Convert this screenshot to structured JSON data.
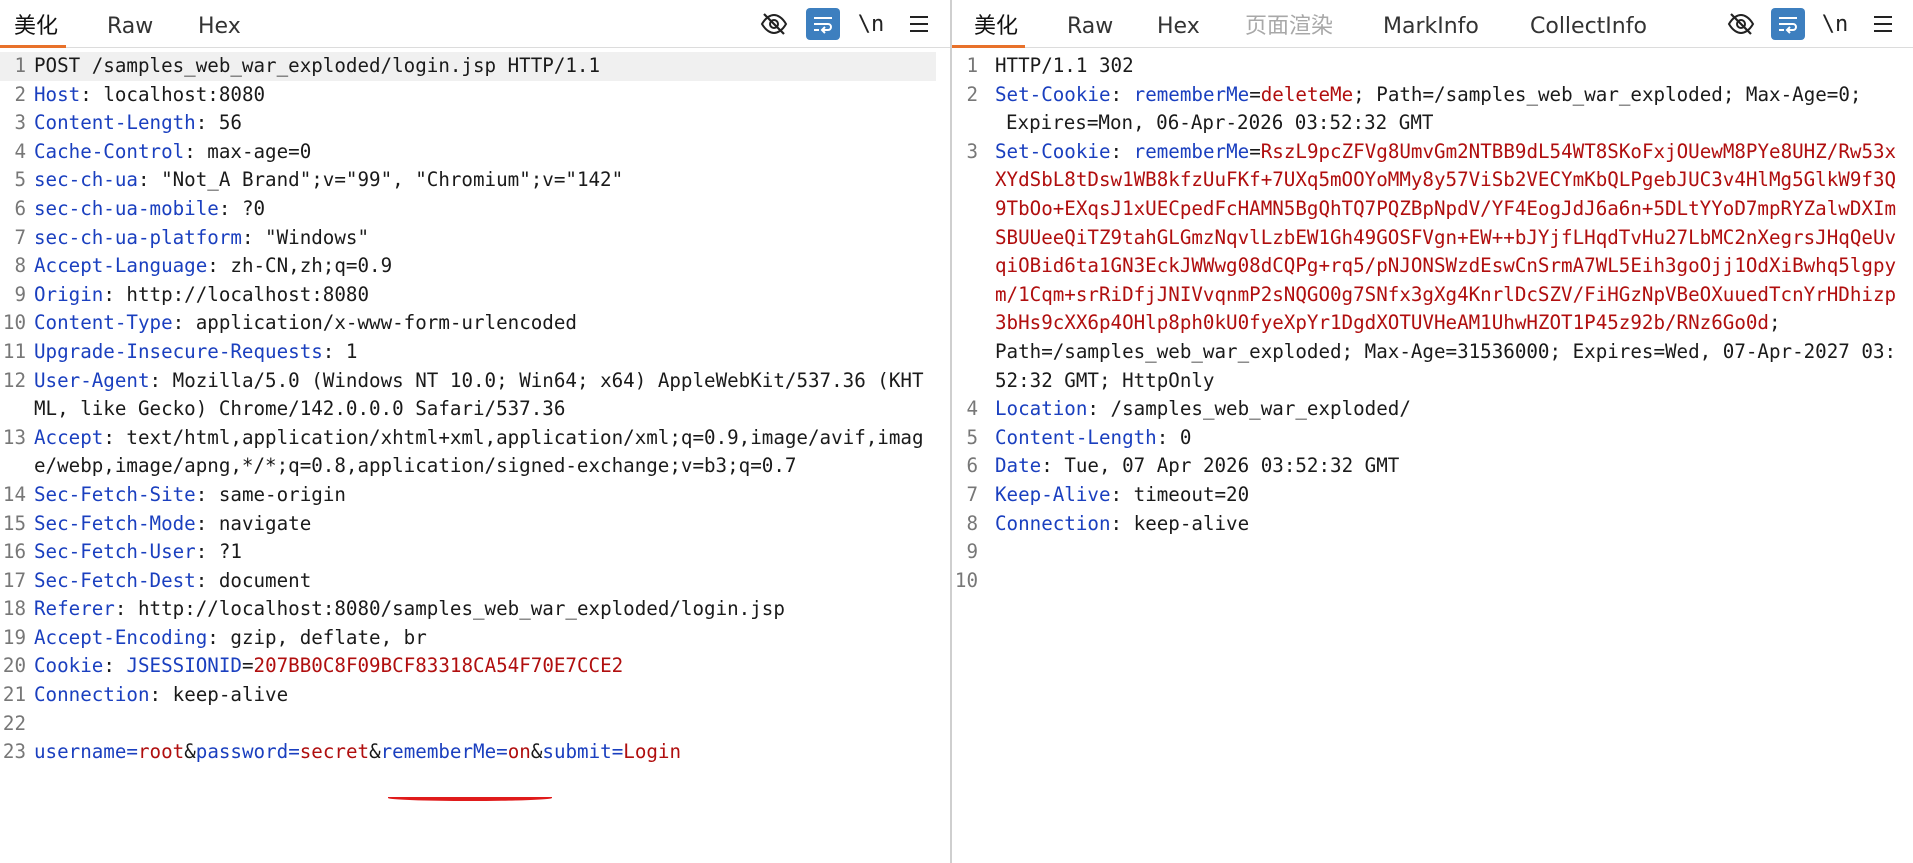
{
  "request_pane": {
    "tabs": [
      "美化",
      "Raw",
      "Hex"
    ],
    "active_tab": "美化",
    "toolbar": {
      "hide_icon": "eye-slash-icon",
      "wrap_icon": "wrap-lines-icon",
      "newline_label": "\\n",
      "menu_icon": "hamburger-menu-icon"
    },
    "lines": [
      {
        "n": "1",
        "request_line": "POST /samples_web_war_exploded/login.jsp HTTP/1.1"
      },
      {
        "n": "2",
        "name": "Host",
        "value": " localhost:8080"
      },
      {
        "n": "3",
        "name": "Content-Length",
        "value": " 56"
      },
      {
        "n": "4",
        "name": "Cache-Control",
        "value": " max-age=0"
      },
      {
        "n": "5",
        "name": "sec-ch-ua",
        "value": " \"Not_A Brand\";v=\"99\", \"Chromium\";v=\"142\""
      },
      {
        "n": "6",
        "name": "sec-ch-ua-mobile",
        "value": " ?0"
      },
      {
        "n": "7",
        "name": "sec-ch-ua-platform",
        "value": " \"Windows\""
      },
      {
        "n": "8",
        "name": "Accept-Language",
        "value": " zh-CN,zh;q=0.9"
      },
      {
        "n": "9",
        "name": "Origin",
        "value": " http://localhost:8080"
      },
      {
        "n": "10",
        "name": "Content-Type",
        "value": " application/x-www-form-urlencoded"
      },
      {
        "n": "11",
        "name": "Upgrade-Insecure-Requests",
        "value": " 1"
      },
      {
        "n": "12",
        "name": "User-Agent",
        "value": " Mozilla/5.0 (Windows NT 10.0; Win64; x64) AppleWebKit/537.36 (KHTML, like Gecko) Chrome/142.0.0.0 Safari/537.36"
      },
      {
        "n": "13",
        "name": "Accept",
        "value": " text/html,application/xhtml+xml,application/xml;q=0.9,image/avif,image/webp,image/apng,*/*;q=0.8,application/signed-exchange;v=b3;q=0.7"
      },
      {
        "n": "14",
        "name": "Sec-Fetch-Site",
        "value": " same-origin"
      },
      {
        "n": "15",
        "name": "Sec-Fetch-Mode",
        "value": " navigate"
      },
      {
        "n": "16",
        "name": "Sec-Fetch-User",
        "value": " ?1"
      },
      {
        "n": "17",
        "name": "Sec-Fetch-Dest",
        "value": " document"
      },
      {
        "n": "18",
        "name": "Referer",
        "value": " http://localhost:8080/samples_web_war_exploded/login.jsp"
      },
      {
        "n": "19",
        "name": "Accept-Encoding",
        "value": " gzip, deflate, br"
      },
      {
        "n": "20",
        "name": "Cookie",
        "cookie_name": "JSESSIONID",
        "cookie_value": "207BB0C8F09BCF83318CA54F70E7CCE2"
      },
      {
        "n": "21",
        "name": "Connection",
        "value": " keep-alive"
      },
      {
        "n": "22"
      },
      {
        "n": "23",
        "body_params": [
          {
            "k": "username",
            "v": "root"
          },
          {
            "k": "password",
            "v": "secret"
          },
          {
            "k": "rememberMe",
            "v": "on"
          },
          {
            "k": "submit",
            "v": "Login"
          }
        ]
      }
    ]
  },
  "response_pane": {
    "tabs": [
      "美化",
      "Raw",
      "Hex",
      "页面渲染",
      "MarkInfo",
      "CollectInfo"
    ],
    "active_tab": "美化",
    "disabled_tab": "页面渲染",
    "toolbar": {
      "hide_icon": "eye-slash-icon",
      "wrap_icon": "wrap-lines-icon",
      "newline_label": "\\n",
      "menu_icon": "hamburger-menu-icon"
    },
    "lines": [
      {
        "n": "1",
        "status_line": "HTTP/1.1 302"
      },
      {
        "n": "2",
        "name": "Set-Cookie",
        "cookie_name": "rememberMe",
        "cookie_value": "deleteMe",
        "suffix": "; Path=/samples_web_war_exploded; Max-Age=0;",
        "continuation": "Expires=Mon, 06-Apr-2026 03:52:32 GMT"
      },
      {
        "n": "3",
        "name": "Set-Cookie",
        "cookie_name": "rememberMe",
        "cookie_value": "RszL9pcZFVg8UmvGm2NTBB9dL54WT8SKoFxjOUewM8PYe8UHZ/Rw53xXYdSbL8tDsw1WB8kfzUuFKf+7UXq5mOOYoMMy8y57ViSb2VECYmKbQLPgebJUC3v4HlMg5GlkW9f3Q9TbOo+EXqsJ1xUECpedFcHAMN5BgQhTQ7PQZBpNpdV/YF4EogJdJ6a6n+5DLtYYoD7mpRYZalwDXImSBUUeeQiTZ9tahGLGmzNqvlLzbEW1Gh49GOSFVgn+EW++bJYjfLHqdTvHu27LbMC2nXegrsJHqQeUvqiOBid6ta1GN3EckJWWwg08dCQPg+rq5/pNJONSWzdEswCnSrmA7WL5Eih3goOjj1OdXiBwhq5lgpym/1Cqm+srRiDfjJNIVvqnmP2sNQGO0g7SNfx3gXg4KnrlDcSZV/FiHGzNpVBeOXuuedTcnYrHDhizp3bHs9cXX6p4OHlp8ph0kU0fyeXpYr1DgdXOTUVHeAM1UhwHZOT1P45z92b/RNz6Go0d",
        "suffix": ";",
        "continuation": "Path=/samples_web_war_exploded; Max-Age=31536000; Expires=Wed, 07-Apr-2027 03:52:32 GMT; HttpOnly"
      },
      {
        "n": "4",
        "name": "Location",
        "value": " /samples_web_war_exploded/"
      },
      {
        "n": "5",
        "name": "Content-Length",
        "value": " 0"
      },
      {
        "n": "6",
        "name": "Date",
        "value": " Tue, 07 Apr 2026 03:52:32 GMT"
      },
      {
        "n": "7",
        "name": "Keep-Alive",
        "value": " timeout=20"
      },
      {
        "n": "8",
        "name": "Connection",
        "value": " keep-alive"
      },
      {
        "n": "9"
      },
      {
        "n": "10"
      }
    ]
  },
  "colors": {
    "header_name": "#1a3fbf",
    "cookie_value": "#b00e0e",
    "active_tab_underline": "#e8712a",
    "wrap_button_bg": "#3d7fbf",
    "annotation_underline": "#e01b1b"
  }
}
